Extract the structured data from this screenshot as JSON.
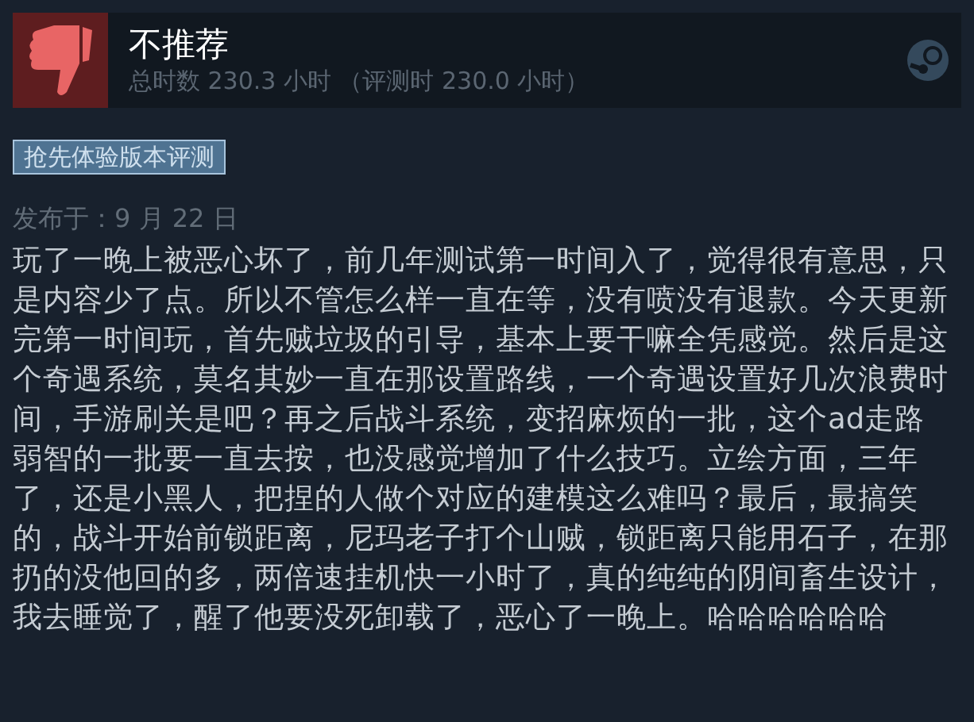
{
  "review": {
    "verdict": "不推荐",
    "recommended": false,
    "hours": "总时数 230.3 小时 （评测时 230.0 小时）",
    "badge": "抢先体验版本评测",
    "date": "发布于：9 月 22 日",
    "body": "玩了一晚上被恶心坏了，前几年测试第一时间入了，觉得很有意思，只是内容少了点。所以不管怎么样一直在等，没有喷没有退款。今天更新完第一时间玩，首先贼垃圾的引导，基本上要干嘛全凭感觉。然后是这个奇遇系统，莫名其妙一直在那设置路线，一个奇遇设置好几次浪费时间，手游刷关是吧？再之后战斗系统，变招麻烦的一批，这个ad走路弱智的一批要一直去按，也没感觉增加了什么技巧。立绘方面，三年了，还是小黑人，把捏的人做个对应的建模这么难吗？最后，最搞笑的，战斗开始前锁距离，尼玛老子打个山贼，锁距离只能用石子，在那扔的没他回的多，两倍速挂机快一小时了，真的纯纯的阴间畜生设计，我去睡觉了，醒了他要没死卸载了，恶心了一晚上。哈哈哈哈哈哈"
  }
}
